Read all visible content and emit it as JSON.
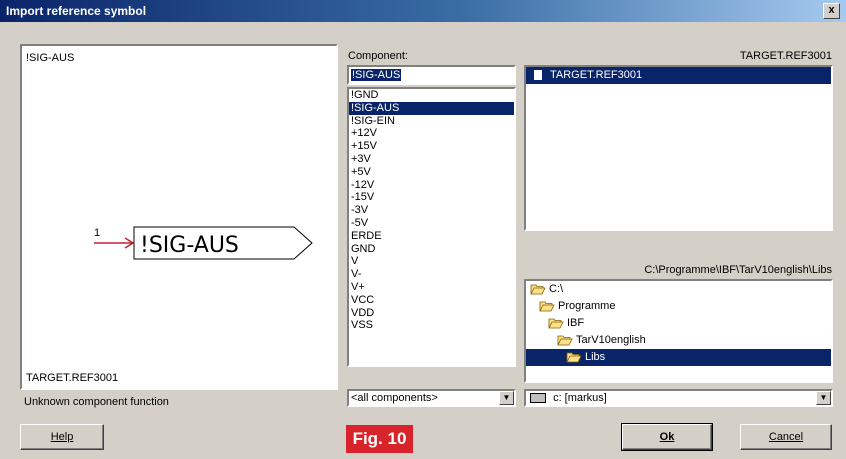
{
  "window": {
    "title": "Import reference symbol",
    "close_label": "x"
  },
  "preview": {
    "symbol_name": "!SIG-AUS",
    "pin_number": "1",
    "symbol_text": "!SIG-AUS",
    "library": "TARGET.REF3001",
    "description": "Unknown component function"
  },
  "component": {
    "label": "Component:",
    "input_value": "!SIG-AUS",
    "items": [
      "!GND",
      "!SIG-AUS",
      "!SIG-EIN",
      "+12V",
      "+15V",
      "+3V",
      "+5V",
      "-12V",
      "-15V",
      "-3V",
      "-5V",
      "ERDE",
      "GND",
      "V",
      "V-",
      "V+",
      "VCC",
      "VDD",
      "VSS"
    ],
    "selected": "!SIG-AUS",
    "filter_value": "<all components>"
  },
  "files": {
    "header": "TARGET.REF3001",
    "items": [
      "TARGET.REF3001"
    ]
  },
  "directory": {
    "path": "C:\\Programme\\IBF\\TarV10english\\Libs",
    "tree": [
      {
        "label": "C:\\",
        "indent": 0,
        "selected": false
      },
      {
        "label": "Programme",
        "indent": 1,
        "selected": false
      },
      {
        "label": "IBF",
        "indent": 2,
        "selected": false
      },
      {
        "label": "TarV10english",
        "indent": 3,
        "selected": false
      },
      {
        "label": "Libs",
        "indent": 4,
        "selected": true
      }
    ],
    "drive_value": "c: [markus]"
  },
  "buttons": {
    "help": "Help",
    "ok": "Ok",
    "cancel": "Cancel"
  },
  "figure_label": "Fig. 10"
}
